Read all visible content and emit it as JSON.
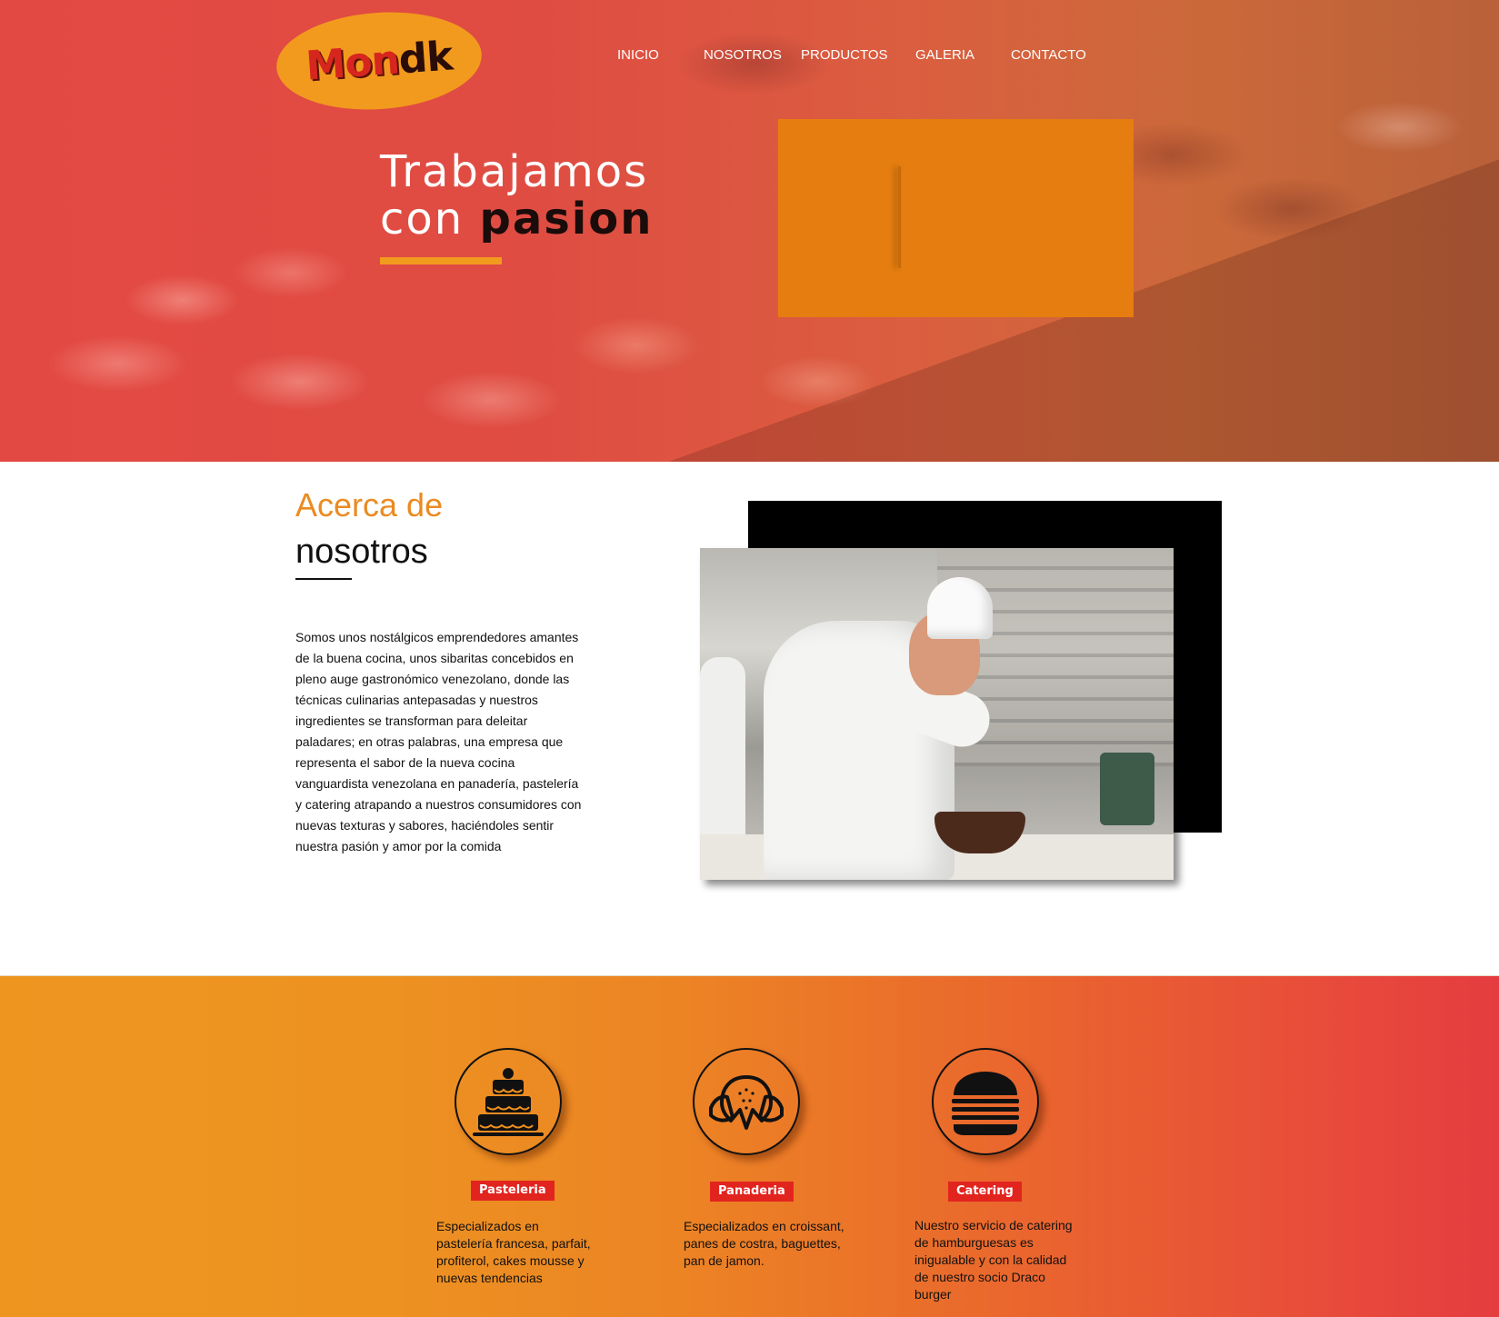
{
  "header": {
    "logo_text_main": "Mon",
    "logo_text_end": "dk",
    "nav": [
      "INICIO",
      "NOSOTROS",
      "PRODUCTOS",
      "GALERIA",
      "CONTACTO"
    ]
  },
  "hero": {
    "line1": "Trabajamos",
    "line2_regular": "con",
    "line2_bold": "pasion"
  },
  "about": {
    "title_line1": "Acerca de",
    "title_line2": "nosotros",
    "body": " Somos unos nostálgicos emprendedores amantes de la buena cocina, unos sibaritas concebidos en pleno auge gastronómico venezolano, donde las técnicas culinarias antepasadas y nuestros ingredientes se transforman para deleitar paladares; en otras palabras, una empresa que representa el sabor de la nueva cocina vanguardista venezolana en panadería, pastelería y catering atrapando a nuestros consumidores con nuevas texturas y sabores, haciéndoles sentir nuestra pasión y amor por la comida"
  },
  "services": [
    {
      "icon": "cake-icon",
      "label": "Pasteleria",
      "description": "Especializados en pastelería francesa, parfait, profiterol, cakes mousse y nuevas tendencias"
    },
    {
      "icon": "croissant-icon",
      "label": "Panaderia",
      "description": "Especializados en croissant, panes de costra, baguettes, pan de jamon."
    },
    {
      "icon": "burger-icon",
      "label": "Catering",
      "description": "Nuestro servicio de catering de hamburguesas es inigualable y con la calidad de nuestro socio Draco burger"
    }
  ],
  "colors": {
    "accent_orange": "#f29a1e",
    "hero_box": "#e57d10",
    "badge_red": "#e2241e",
    "title_orange": "#ea8b22"
  }
}
